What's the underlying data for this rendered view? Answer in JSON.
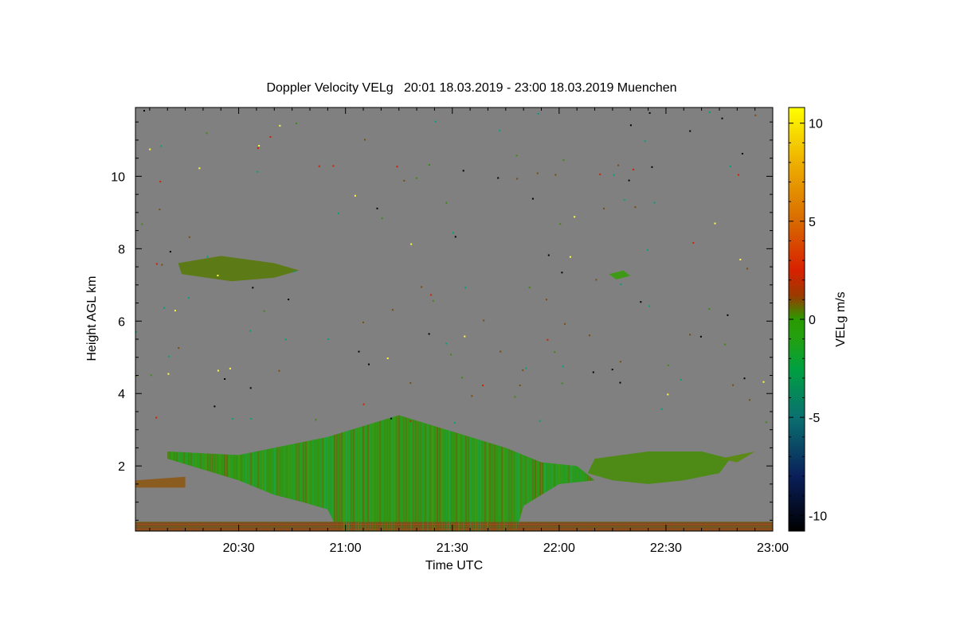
{
  "chart_data": {
    "type": "heatmap",
    "title": "Doppler Velocity VELg   20:01 18.03.2019 - 23:00 18.03.2019 Muenchen",
    "xlabel": "Time UTC",
    "ylabel": "Height AGL km",
    "colorbar_label": "VELg m/s",
    "x_range": [
      "20:01",
      "23:00"
    ],
    "y_range_km": [
      0.2,
      11.9
    ],
    "x_ticks": [
      "20:30",
      "21:00",
      "21:30",
      "22:00",
      "22:30",
      "23:00"
    ],
    "y_ticks": [
      2,
      4,
      6,
      8,
      10
    ],
    "colorbar_range": [
      -10.8,
      10.8
    ],
    "colorbar_ticks": [
      10,
      5,
      0,
      -5,
      -10
    ],
    "colormap_stops": [
      {
        "v": -10.8,
        "color": "#000000"
      },
      {
        "v": -8.0,
        "color": "#0a1f5a"
      },
      {
        "v": -5.0,
        "color": "#0a7070"
      },
      {
        "v": -2.5,
        "color": "#00a040"
      },
      {
        "v": -1.0,
        "color": "#22a010"
      },
      {
        "v": 0.0,
        "color": "#2a9a00"
      },
      {
        "v": 1.2,
        "color": "#9a3a00"
      },
      {
        "v": 2.5,
        "color": "#d82000"
      },
      {
        "v": 5.0,
        "color": "#d86a00"
      },
      {
        "v": 8.0,
        "color": "#eeb000"
      },
      {
        "v": 10.8,
        "color": "#ffff00"
      }
    ],
    "background_no_signal_color": "#808080",
    "regions": [
      {
        "name": "main-precipitation",
        "color": "#2a9a10",
        "outline": [
          [
            "20:10",
            2.4
          ],
          [
            "20:30",
            2.3
          ],
          [
            "20:45",
            2.6
          ],
          [
            "20:55",
            2.8
          ],
          [
            "21:05",
            3.1
          ],
          [
            "21:15",
            3.4
          ],
          [
            "21:25",
            3.1
          ],
          [
            "21:35",
            2.8
          ],
          [
            "21:45",
            2.5
          ],
          [
            "21:55",
            2.1
          ],
          [
            "22:05",
            2.0
          ],
          [
            "22:10",
            1.6
          ],
          [
            "22:00",
            1.5
          ],
          [
            "21:50",
            0.9
          ],
          [
            "21:48",
            0.2
          ],
          [
            "20:58",
            0.2
          ],
          [
            "20:55",
            0.8
          ],
          [
            "20:48",
            1.0
          ],
          [
            "20:40",
            1.2
          ],
          [
            "20:30",
            1.6
          ],
          [
            "20:10",
            2.2
          ]
        ]
      },
      {
        "name": "low-layer-left",
        "color": "#8a5a1a",
        "outline": [
          [
            "20:01",
            1.6
          ],
          [
            "20:15",
            1.7
          ],
          [
            "20:15",
            1.4
          ],
          [
            "20:01",
            1.4
          ]
        ]
      },
      {
        "name": "right-cloud",
        "color": "#4a8a10",
        "outline": [
          [
            "22:10",
            2.2
          ],
          [
            "22:25",
            2.4
          ],
          [
            "22:40",
            2.4
          ],
          [
            "22:48",
            2.2
          ],
          [
            "22:45",
            1.8
          ],
          [
            "22:35",
            1.6
          ],
          [
            "22:25",
            1.5
          ],
          [
            "22:15",
            1.6
          ],
          [
            "22:08",
            1.8
          ]
        ]
      },
      {
        "name": "right-fragment",
        "color": "#5a8a10",
        "outline": [
          [
            "22:45",
            2.2
          ],
          [
            "22:55",
            2.4
          ],
          [
            "22:50",
            2.1
          ]
        ]
      },
      {
        "name": "upper-cloud-left",
        "color": "#5a7a10",
        "outline": [
          [
            "20:13",
            7.6
          ],
          [
            "20:25",
            7.8
          ],
          [
            "20:40",
            7.6
          ],
          [
            "20:47",
            7.4
          ],
          [
            "20:40",
            7.2
          ],
          [
            "20:28",
            7.1
          ],
          [
            "20:14",
            7.3
          ]
        ]
      },
      {
        "name": "upper-cloud-right",
        "color": "#3a9a10",
        "outline": [
          [
            "22:14",
            7.3
          ],
          [
            "22:18",
            7.4
          ],
          [
            "22:20",
            7.25
          ],
          [
            "22:16",
            7.15
          ]
        ]
      },
      {
        "name": "surface-band",
        "color": "#7a4a1a",
        "outline": [
          [
            "20:01",
            0.45
          ],
          [
            "23:00",
            0.45
          ],
          [
            "23:00",
            0.2
          ],
          [
            "20:01",
            0.2
          ]
        ]
      }
    ]
  }
}
